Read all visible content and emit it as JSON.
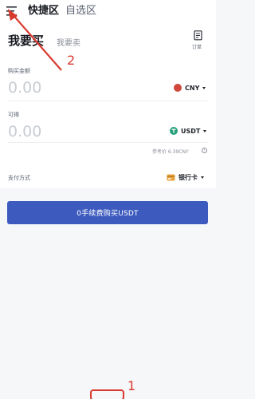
{
  "header": {
    "tabs": [
      {
        "label": "快捷区"
      },
      {
        "label": "自选区"
      }
    ]
  },
  "trade": {
    "title": "我要买",
    "alt_title": "我要卖",
    "orders_label": "订单",
    "pay_amount": {
      "label": "购买金额",
      "placeholder": "0.00",
      "currency": "CNY"
    },
    "receive": {
      "label": "可得",
      "placeholder": "0.00",
      "currency": "USDT"
    },
    "reference_price": "参考价 6.39CNY",
    "payment": {
      "label": "支付方式",
      "method": "银行卡"
    },
    "buy_button": "0手续费购买USDT"
  },
  "annotations": {
    "marker_1": "1",
    "marker_2": "2"
  },
  "colors": {
    "accent": "#3d5bbf",
    "annotation": "#d93a2f",
    "cny_coin": "#d0473b",
    "usdt_coin": "#26a17b",
    "bank_card": "#e7a33e"
  }
}
